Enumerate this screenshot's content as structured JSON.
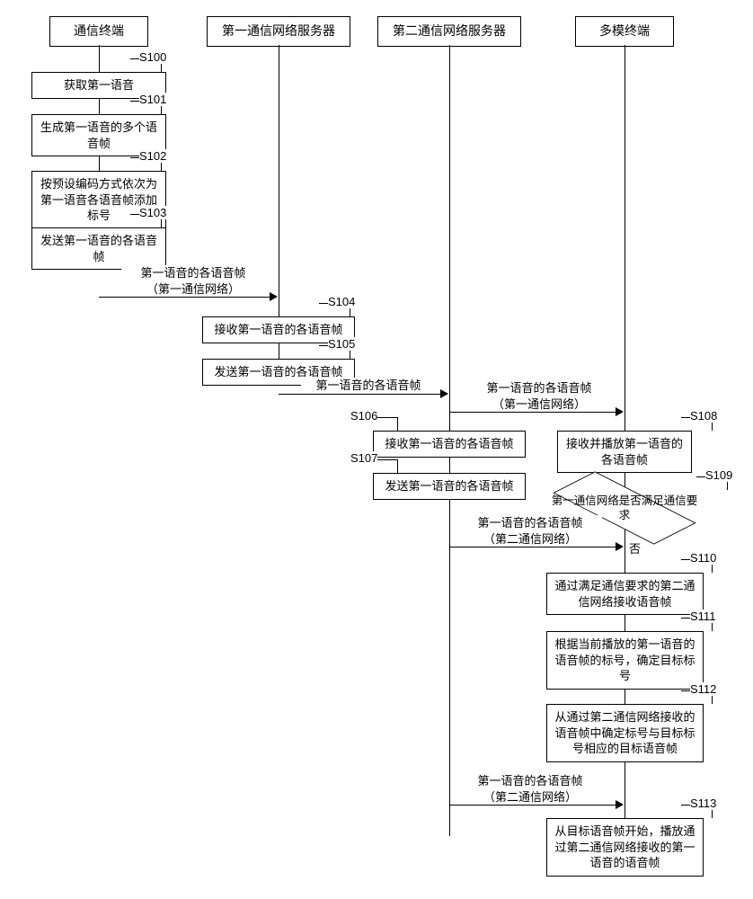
{
  "lanes": {
    "terminal": "通信终端",
    "server1": "第一通信网络服务器",
    "server2": "第二通信网络服务器",
    "multimode": "多模终端"
  },
  "steps": {
    "s100": "获取第一语音",
    "s101": "生成第一语音的多个语音帧",
    "s102": "按预设编码方式依次为第一语音各语音帧添加标号",
    "s103": "发送第一语音的各语音帧",
    "s104": "接收第一语音的各语音帧",
    "s105": "发送第一语音的各语音帧",
    "s106": "接收第一语音的各语音帧",
    "s107": "发送第一语音的各语音帧",
    "s108": "接收并播放第一语音的各语音帧",
    "s109": "第一通信网络是否满足通信要求",
    "s110": "通过满足通信要求的第二通信网络接收语音帧",
    "s111": "根据当前播放的第一语音的语音帧的标号，确定目标标号",
    "s112": "从通过第二通信网络接收的语音帧中确定标号与目标标号相应的目标语音帧",
    "s113": "从目标语音帧开始，播放通过第二通信网络接收的第一语音的语音帧"
  },
  "labels": {
    "s100": "S100",
    "s101": "S101",
    "s102": "S102",
    "s103": "S103",
    "s104": "S104",
    "s105": "S105",
    "s106": "S106",
    "s107": "S107",
    "s108": "S108",
    "s109": "S109",
    "s110": "S110",
    "s111": "S111",
    "s112": "S112",
    "s113": "S113"
  },
  "messages": {
    "m1": "第一语音的各语音帧",
    "m1net": "（第一通信网络）",
    "m2": "第一语音的各语音帧",
    "m3": "第一语音的各语音帧",
    "m3net": "（第一通信网络）",
    "m4": "第一语音的各语音帧",
    "m4net": "（第二通信网络）",
    "m5": "第一语音的各语音帧",
    "m5net": "（第二通信网络）"
  },
  "branch": {
    "no": "否"
  }
}
